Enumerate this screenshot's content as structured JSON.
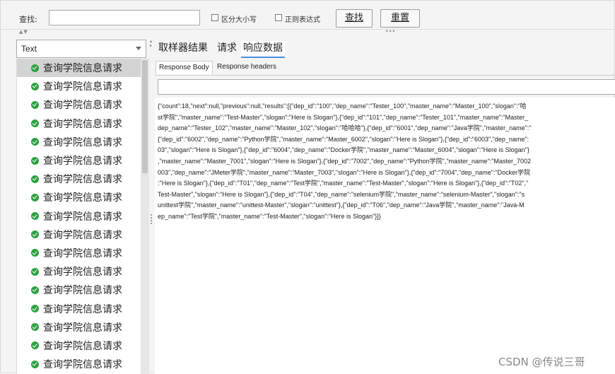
{
  "search": {
    "label": "查找:",
    "value": "",
    "case_label": "区分大小写",
    "regex_label": "正则表达式",
    "find_label": "查找",
    "reset_label": "重置"
  },
  "left": {
    "view_select": "Text",
    "items": [
      "查询学院信息请求",
      "查询学院信息请求",
      "查询学院信息请求",
      "查询学院信息请求",
      "查询学院信息请求",
      "查询学院信息请求",
      "查询学院信息请求",
      "查询学院信息请求",
      "查询学院信息请求",
      "查询学院信息请求",
      "查询学院信息请求",
      "查询学院信息请求",
      "查询学院信息请求",
      "查询学院信息请求",
      "查询学院信息请求",
      "查询学院信息请求",
      "查询学院信息请求",
      "查询学院信息请求"
    ]
  },
  "right": {
    "tabs": [
      "取样器结果",
      "请求",
      "响应数据"
    ],
    "active_tab": 2,
    "subtabs": [
      "Response Body",
      "Response headers"
    ],
    "search_value": "",
    "response_lines": [
      "{\"count\":18,\"next\":null,\"previous\":null,\"results\":[{\"dep_id\":\"100\",\"dep_name\":\"Tester_100\",\"master_name\":\"Master_100\",\"slogan\":\"哈",
      "st学院\",\"master_name\":\"Test-Master\",\"slogan\":\"Here is Slogan\"},{\"dep_id\":\"101\",\"dep_name\":\"Tester_101\",\"master_name\":\"Master_",
      "dep_name\":\"Tester_102\",\"master_name\":\"Master_102\",\"slogan\":\"哈哈哈\"},{\"dep_id\":\"6001\",\"dep_name\":\"Java学院\",\"master_name\":\"",
      "{\"dep_id\":\"6002\",\"dep_name\":\"Python学院\",\"master_name\":\"Master_6002\",\"slogan\":\"Here is Slogan\"},{\"dep_id\":\"6003\",\"dep_name\":",
      "03\",\"slogan\":\"Here is Slogan\"},{\"dep_id\":\"6004\",\"dep_name\":\"Docker学院\",\"master_name\":\"Master_6004\",\"slogan\":\"Here is Slogan\"}",
      ",\"master_name\":\"Master_7001\",\"slogan\":\"Here is Slogan\"},{\"dep_id\":\"7002\",\"dep_name\":\"Python学院\",\"master_name\":\"Master_7002",
      "003\",\"dep_name\":\"JMeter学院\",\"master_name\":\"Master_7003\",\"slogan\":\"Here is Slogan\"},{\"dep_id\":\"7004\",\"dep_name\":\"Docker学院",
      ":\"Here is Slogan\"},{\"dep_id\":\"T01\",\"dep_name\":\"Test学院\",\"master_name\":\"Test-Master\",\"slogan\":\"Here is Slogan\"},{\"dep_id\":\"T02\",\"",
      "Test-Master\",\"slogan\":\"Here is Slogan\"},{\"dep_id\":\"T04\",\"dep_name\":\"selenium学院\",\"master_name\":\"selenium-Master\",\"slogan\":\"s",
      "unittest学院\",\"master_name\":\"unittest-Master\",\"slogan\":\"unittest\"},{\"dep_id\":\"T06\",\"dep_name\":\"Java学院\",\"master_name\":\"Java-M",
      "ep_name\":\"Test学院\",\"master_name\":\"Test-Master\",\"slogan\":\"Here is Slogan\"}]}"
    ]
  },
  "watermark": "CSDN @传说三哥"
}
